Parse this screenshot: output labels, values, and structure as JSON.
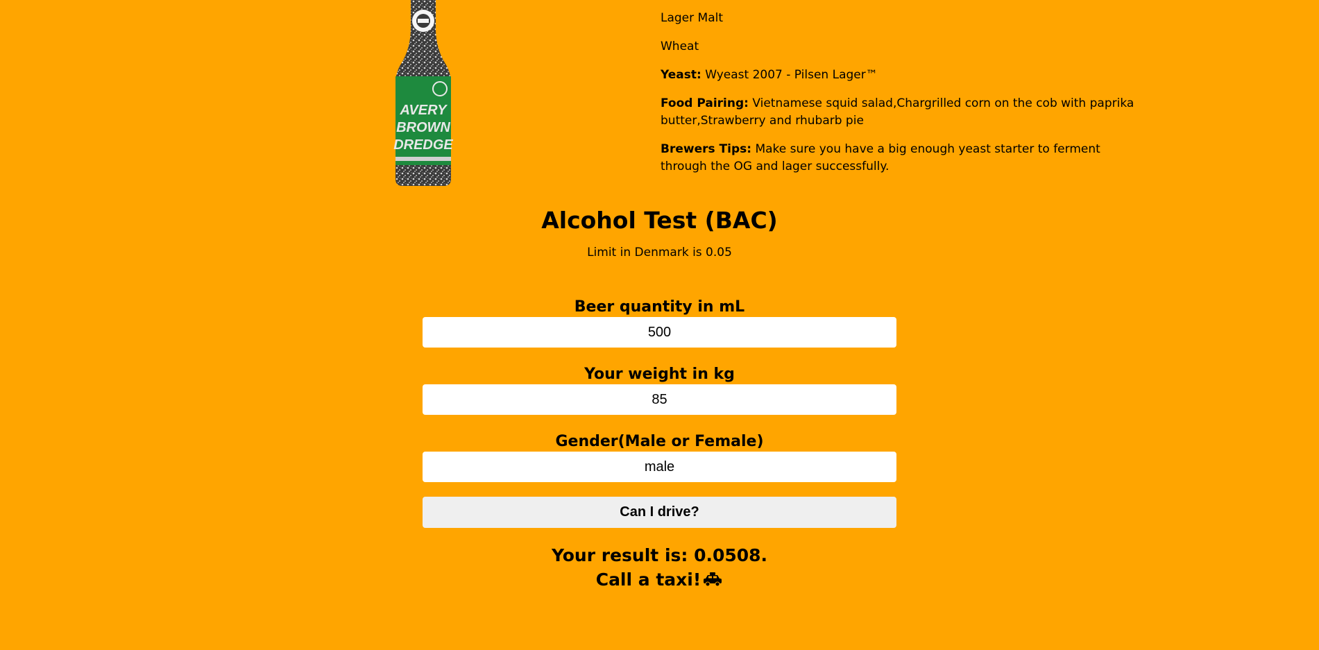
{
  "beer": {
    "bottle_image": "beer-bottle-image",
    "label_text": "AVERY BROWN DREDGE"
  },
  "info": {
    "malts": [
      "Lager Malt",
      "Wheat"
    ],
    "yeast_label": "Yeast:",
    "yeast_value": "Wyeast 2007 - Pilsen Lager™",
    "food_label": "Food Pairing:",
    "food_value": "Vietnamese squid salad,Chargrilled corn on the cob with paprika butter,Strawberry and rhubarb pie",
    "tips_label": "Brewers Tips:",
    "tips_value": "Make sure you have a big enough yeast starter to ferment through the OG and lager successfully."
  },
  "bac": {
    "title": "Alcohol Test (BAC)",
    "limit": "Limit in Denmark is 0.05",
    "quantity_label": "Beer quantity in mL",
    "quantity_value": "500",
    "weight_label": "Your weight in kg",
    "weight_value": "85",
    "gender_label": "Gender(Male or Female)",
    "gender_value": "male",
    "button_label": "Can I drive?",
    "result_line": "Your result is: 0.0508.",
    "verdict": "Call a taxi!",
    "verdict_icon": "taxi-icon"
  },
  "colors": {
    "background": "#FFA500",
    "input_bg": "#FFFFFF",
    "button_bg": "#EFEFEF",
    "bottle_label": "#1E8A3E"
  }
}
